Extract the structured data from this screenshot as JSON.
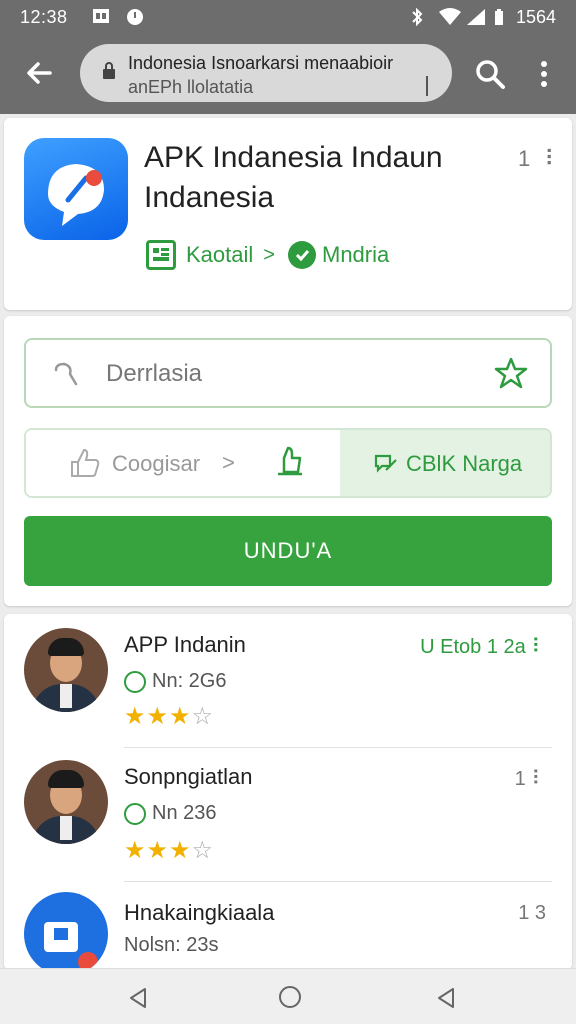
{
  "status_bar": {
    "time": "12:38",
    "right_time": "1564"
  },
  "browser": {
    "url_line1": "Indonesia Isnoarkarsi menaabioir",
    "url_line2": "anEPh llolatatia"
  },
  "app": {
    "title": "APK Indanesia Indaun Indanesia",
    "more": "1 ⠇",
    "tag1": "Kaotail",
    "tag1_chevron": ">",
    "tag2": "Mndria"
  },
  "actions": {
    "search_text": "Derrlasia",
    "seg_left_label": "Coogisar",
    "seg_left_chevron": ">",
    "seg_right_label": "CBlK Narga",
    "download_label": "UNDU'A"
  },
  "list": [
    {
      "title": "APP Indanin",
      "sub": "Nn: 2G6",
      "meta": "U Etob 1 2a ⠇",
      "stars_on": 3,
      "stars_total": 4
    },
    {
      "title": "Sonpngiatlan",
      "sub": "Nn 236",
      "meta": "1 ⠇",
      "stars_on": 3,
      "stars_total": 4
    },
    {
      "title": "Hnakaingkiaala",
      "sub": "Nolsn: 23s",
      "meta": "1 3",
      "stars_on": 0,
      "stars_total": 0
    }
  ],
  "colors": {
    "accent": "#37a33f",
    "toolbar": "#6d6d6d",
    "star": "#f2b100"
  },
  "icons": [
    "back-arrow-icon",
    "lock-icon",
    "search-icon",
    "overflow-menu-icon",
    "chat-bubble-icon",
    "star-icon",
    "thumbs-up-icon",
    "nav-back-icon",
    "nav-home-icon",
    "nav-recent-icon"
  ]
}
